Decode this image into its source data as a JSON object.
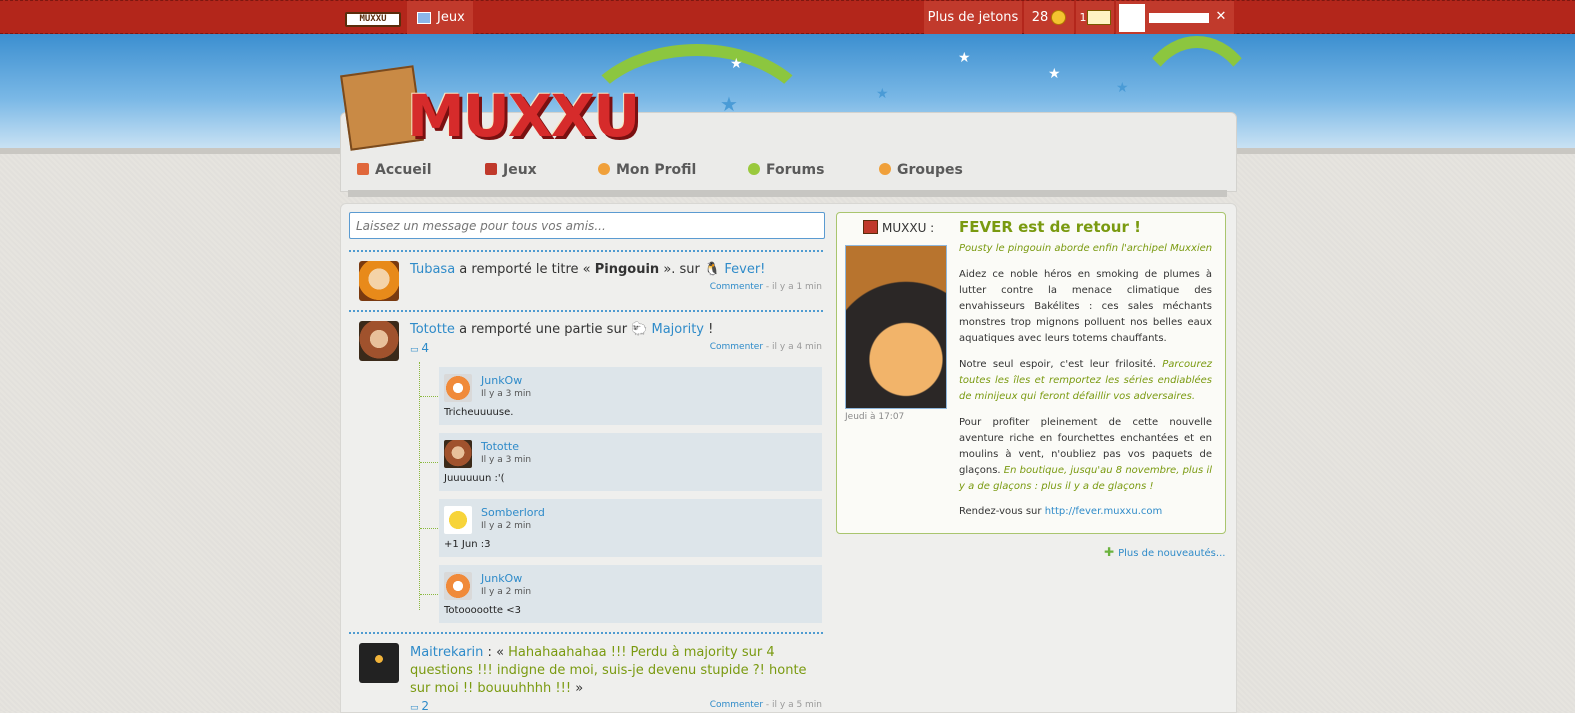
{
  "topbar": {
    "logo_text": "MUXXU",
    "games_label": "Jeux",
    "more_tokens_label": "Plus de jetons",
    "token_count": "28",
    "mail_count": "1"
  },
  "header": {
    "logo_text": "MUXXU"
  },
  "nav": [
    {
      "label": "Accueil",
      "icon": "home-icon"
    },
    {
      "label": "Jeux",
      "icon": "games-icon"
    },
    {
      "label": "Mon Profil",
      "icon": "profile-icon"
    },
    {
      "label": "Forums",
      "icon": "forum-icon"
    },
    {
      "label": "Groupes",
      "icon": "groups-icon"
    }
  ],
  "feed": {
    "input_placeholder": "Laissez un message pour tous vos amis...",
    "items": [
      {
        "user": "Tubasa",
        "text_before": " a remporté le titre « ",
        "bold": "Pingouin",
        "text_after": " ». sur ",
        "game": "Fever!",
        "comment_label": "Commenter",
        "time": " - il y a 1 min"
      },
      {
        "user": "Tototte",
        "text_before": " a remporté une partie sur ",
        "game": "Majority",
        "text_after": " !",
        "comment_count": "4",
        "comment_label": "Commenter",
        "time": " - il y a 4 min",
        "comments": [
          {
            "user": "JunkOw",
            "time": "Il y a 3 min",
            "text": "Tricheuuuuse."
          },
          {
            "user": "Tototte",
            "time": "Il y a 3 min",
            "text": "Juuuuuun :'("
          },
          {
            "user": "Somberlord",
            "time": "Il y a 2 min",
            "text": "+1 Jun :3"
          },
          {
            "user": "JunkOw",
            "time": "Il y a 2 min",
            "text": "Totoooootte <3"
          }
        ]
      },
      {
        "user": "Maitrekarin",
        "text_before": " : « ",
        "quote": "Hahahaahahaa !!! Perdu à majority sur 4 questions !!! indigne de moi, suis-je devenu stupide ?! honte sur moi !! bouuuhhhh !!!",
        "text_after": " »",
        "comment_count": "2",
        "comment_label": "Commenter",
        "time": " - il y a 5 min"
      }
    ]
  },
  "news": {
    "source": "MUXXU :",
    "date": "Jeudi à 17:07",
    "title": "FEVER est de retour !",
    "subtitle": "Pousty le pingouin aborde enfin l'archipel Muxxien",
    "p1": "Aidez ce noble héros en smoking de plumes à lutter contre la menace climatique des envahisseurs Bakélites : ces sales méchants monstres trop mignons polluent nos belles eaux aquatiques avec leurs totems chauffants.",
    "p2_plain": "Notre seul espoir, c'est leur frilosité. ",
    "p2_hl": "Parcourez toutes les îles et remportez les séries endiablées de minijeux qui feront défaillir vos adversaires.",
    "p3_plain": "Pour profiter pleinement de cette nouvelle aventure riche en fourchettes enchantées et en moulins à vent, n'oubliez pas vos paquets de glaçons. ",
    "p3_hl": "En boutique, jusqu'au 8 novembre, plus il y a de glaçons : plus il y a de glaçons !",
    "p4_plain": "Rendez-vous sur ",
    "p4_link": "http://fever.muxxu.com",
    "more_label": "Plus de nouveautés..."
  }
}
